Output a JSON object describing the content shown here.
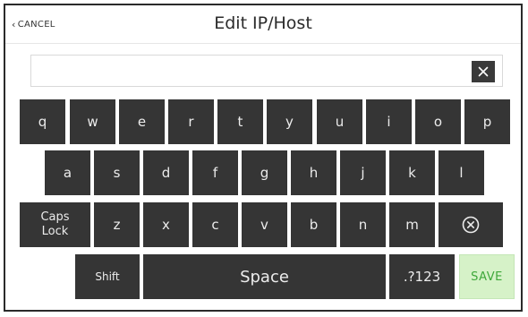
{
  "header": {
    "cancel_label": "CANCEL",
    "title": "Edit IP/Host"
  },
  "input": {
    "value": "",
    "placeholder": "",
    "clear_icon": "close-icon"
  },
  "keyboard": {
    "row1": [
      "q",
      "w",
      "e",
      "r",
      "t",
      "y",
      "u",
      "i",
      "o",
      "p"
    ],
    "row2": [
      "a",
      "s",
      "d",
      "f",
      "g",
      "h",
      "j",
      "k",
      "l"
    ],
    "row3": [
      "z",
      "x",
      "c",
      "v",
      "b",
      "n",
      "m"
    ],
    "caps_line1": "Caps",
    "caps_line2": "Lock",
    "backspace_icon": "backspace-icon",
    "shift": "Shift",
    "space": "Space",
    "numeric": ".?123",
    "save": "SAVE"
  },
  "colors": {
    "key_bg": "#353535",
    "key_text": "#ececec",
    "save_bg": "#d6f2c8",
    "save_text": "#3fa83a"
  }
}
